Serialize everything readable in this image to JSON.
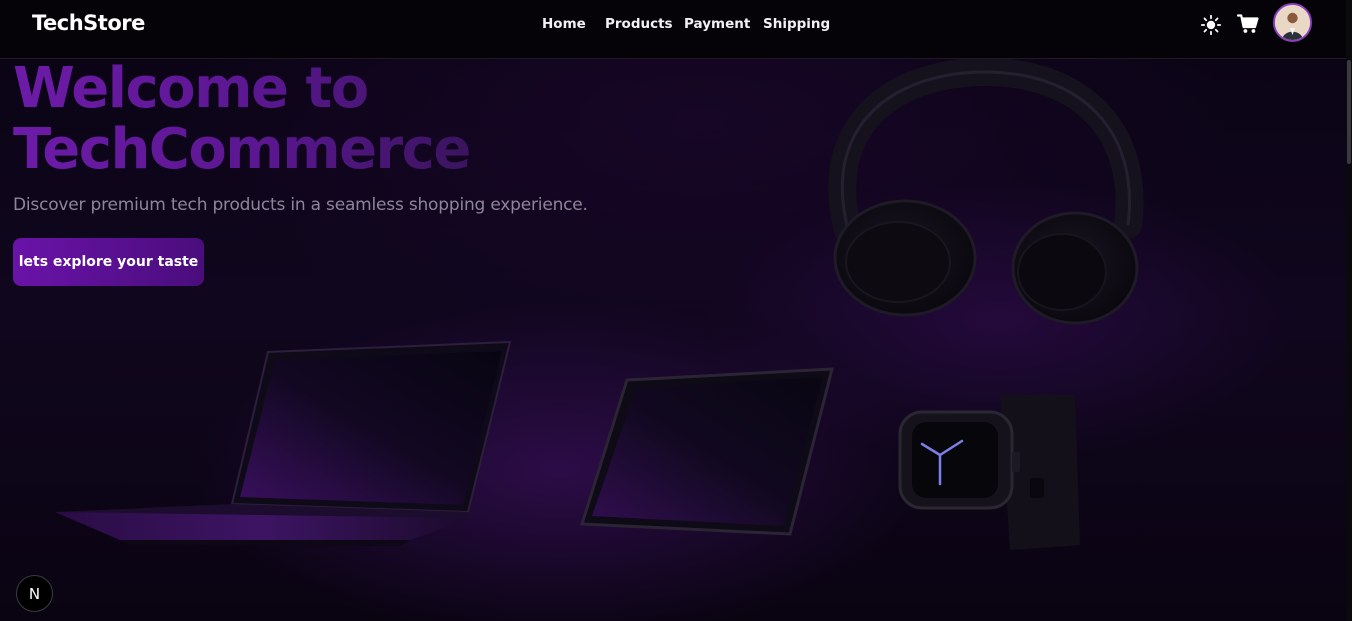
{
  "navbar": {
    "brand": "TechStore",
    "links": [
      {
        "label": "Home"
      },
      {
        "label": "Products"
      },
      {
        "label": "Payment"
      },
      {
        "label": "Shipping"
      }
    ],
    "icons": [
      "sun-icon",
      "cart-icon",
      "user-avatar"
    ]
  },
  "hero": {
    "headline_line1": "Welcome to",
    "headline_line2": "TechCommerce",
    "subtitle": "Discover premium tech products in a seamless shopping experience.",
    "cta_label": "lets explore your taste"
  },
  "badge": {
    "label": "N"
  },
  "colors": {
    "accent": "#6a13a8",
    "background": "#07030d",
    "nav_background": "#050208"
  }
}
